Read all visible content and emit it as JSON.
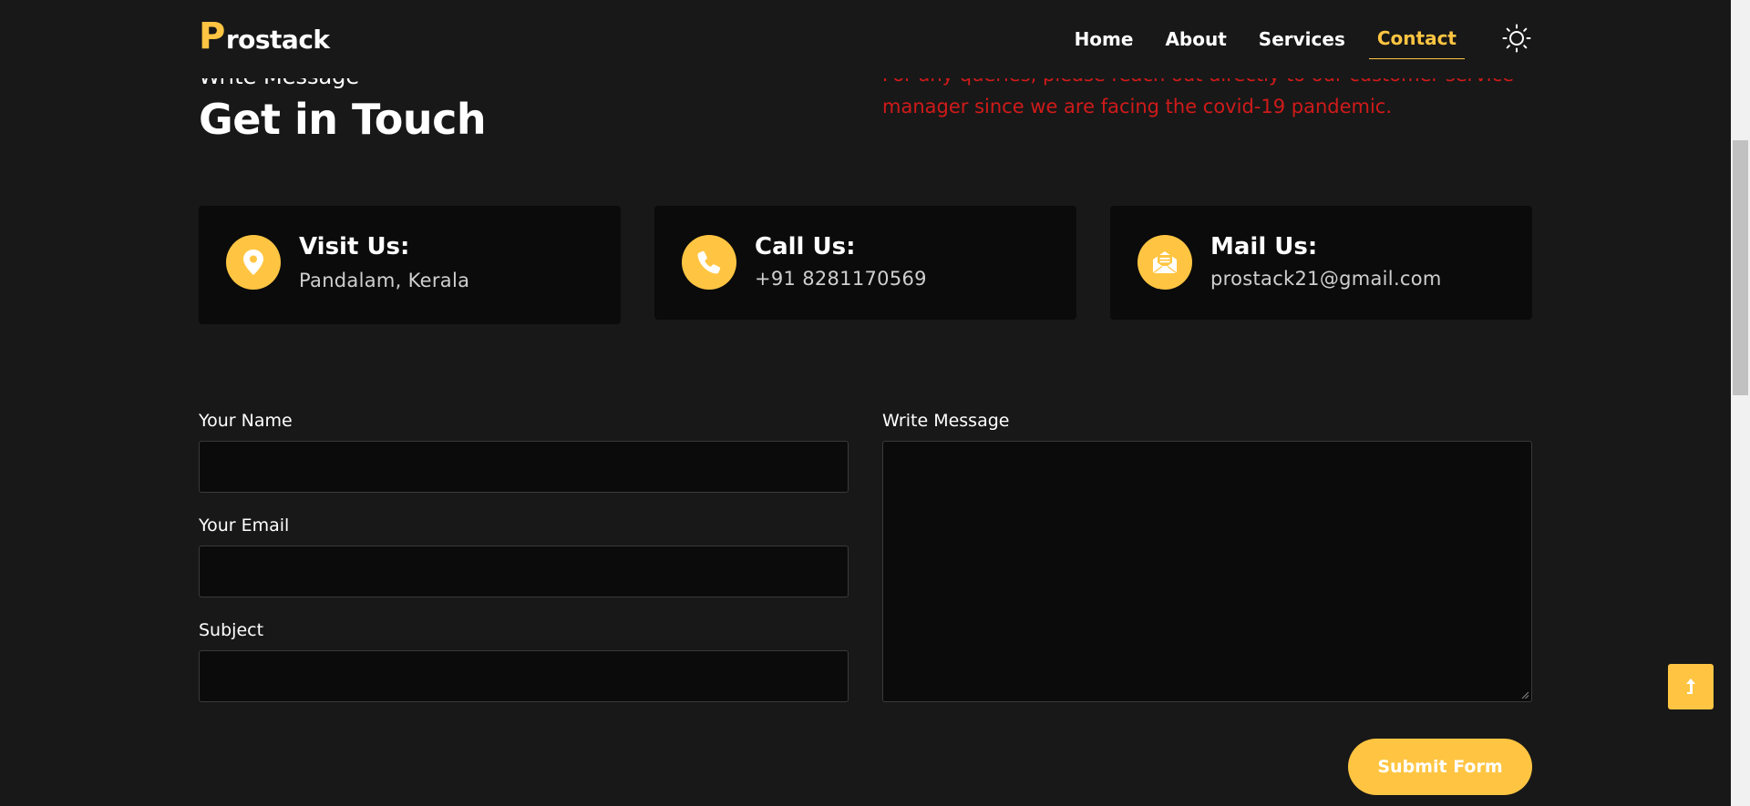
{
  "brand": {
    "first_letter": "P",
    "rest": "rostack"
  },
  "nav": {
    "items": [
      {
        "label": "Home",
        "active": false
      },
      {
        "label": "About",
        "active": false
      },
      {
        "label": "Services",
        "active": false
      },
      {
        "label": "Contact",
        "active": true
      }
    ],
    "theme_toggle_icon": "sun-icon"
  },
  "hero": {
    "subtitle": "Write Message",
    "title": "Get in Touch",
    "intro": "For any queries, please reach out directly to our customer service manager since we are facing the covid-19 pandemic."
  },
  "cards": [
    {
      "title": "Visit Us:",
      "value": "Pandalam, Kerala",
      "icon": "location-pin-icon"
    },
    {
      "title": "Call Us:",
      "value": "+91 8281170569",
      "icon": "phone-icon"
    },
    {
      "title": "Mail Us:",
      "value": "prostack21@gmail.com",
      "icon": "mail-open-icon"
    }
  ],
  "form": {
    "name_label": "Your Name",
    "name_value": "",
    "email_label": "Your Email",
    "email_value": "",
    "subject_label": "Subject",
    "subject_value": "",
    "message_label": "Write Message",
    "message_value": "",
    "submit_label": "Submit Form"
  },
  "back_to_top_icon": "arrow-up-icon",
  "colors": {
    "background": "#181818",
    "card": "#0b0b0b",
    "accent": "#ffc542",
    "intro_text": "#d01a1a"
  }
}
